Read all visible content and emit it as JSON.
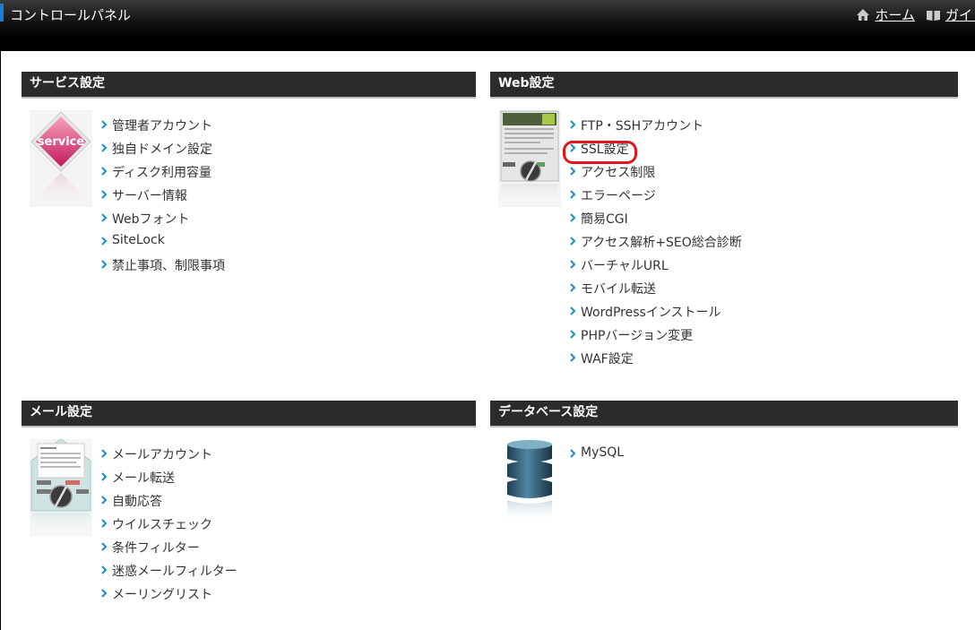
{
  "header": {
    "title": "コントロールパネル",
    "nav": [
      {
        "label": "ホーム",
        "icon": "home-icon"
      },
      {
        "label": "ガイド",
        "icon": "book-icon"
      }
    ]
  },
  "sections": {
    "service": {
      "title": "サービス設定",
      "image_label": "service",
      "items": [
        "管理者アカウント",
        "独自ドメイン設定",
        "ディスク利用容量",
        "サーバー情報",
        "Webフォント",
        "SiteLock",
        "禁止事項、制限事項"
      ]
    },
    "web": {
      "title": "Web設定",
      "items": [
        "FTP・SSHアカウント",
        "SSL設定",
        "アクセス制限",
        "エラーページ",
        "簡易CGI",
        "アクセス解析+SEO総合診断",
        "バーチャルURL",
        "モバイル転送",
        "WordPressインストール",
        "PHPバージョン変更",
        "WAF設定"
      ],
      "highlighted_item": "SSL設定"
    },
    "mail": {
      "title": "メール設定",
      "items": [
        "メールアカウント",
        "メール転送",
        "自動応答",
        "ウイルスチェック",
        "条件フィルター",
        "迷惑メールフィルター",
        "メーリングリスト"
      ]
    },
    "database": {
      "title": "データベース設定",
      "items": [
        "MySQL"
      ]
    }
  },
  "colors": {
    "header_bg": "#2b2b2b",
    "accent_blue": "#1a7fd8",
    "link_arrow": "#1a8bd0",
    "highlight_red": "#e2141d"
  }
}
